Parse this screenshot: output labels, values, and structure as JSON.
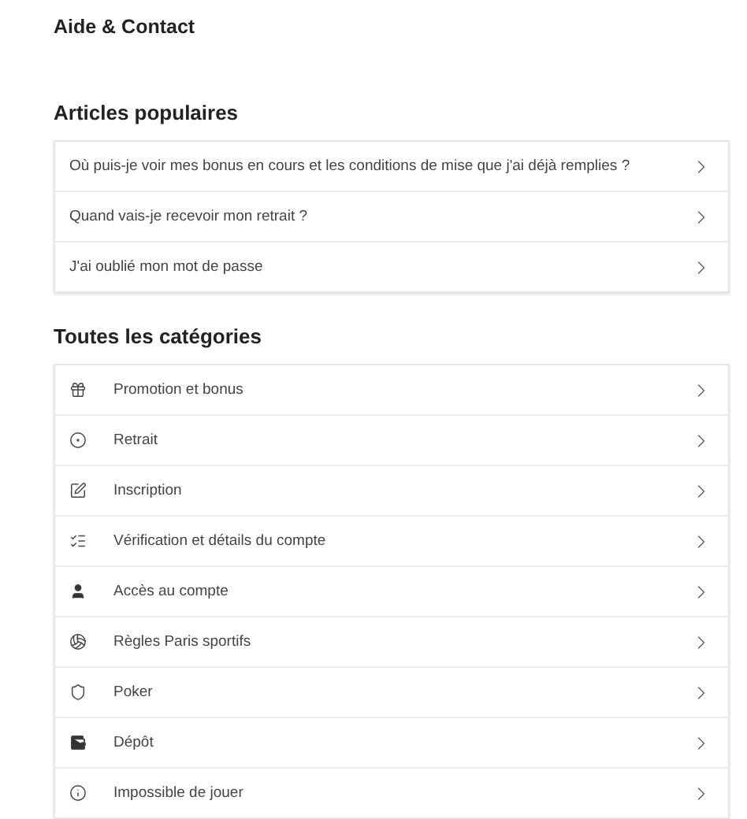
{
  "page_title": "Aide & Contact",
  "popular": {
    "heading": "Articles populaires",
    "items": [
      {
        "label": "Où puis-je voir mes bonus en cours et les conditions de mise que j'ai déjà remplies ?"
      },
      {
        "label": "Quand vais-je recevoir mon retrait ?"
      },
      {
        "label": "J'ai oublié mon mot de passe"
      }
    ]
  },
  "categories": {
    "heading": "Toutes les catégories",
    "items": [
      {
        "label": "Promotion et bonus"
      },
      {
        "label": "Retrait"
      },
      {
        "label": "Inscription"
      },
      {
        "label": "Vérification et détails du compte"
      },
      {
        "label": "Accès au compte"
      },
      {
        "label": "Règles Paris sportifs"
      },
      {
        "label": "Poker"
      },
      {
        "label": "Dépôt"
      },
      {
        "label": "Impossible de jouer"
      }
    ]
  }
}
